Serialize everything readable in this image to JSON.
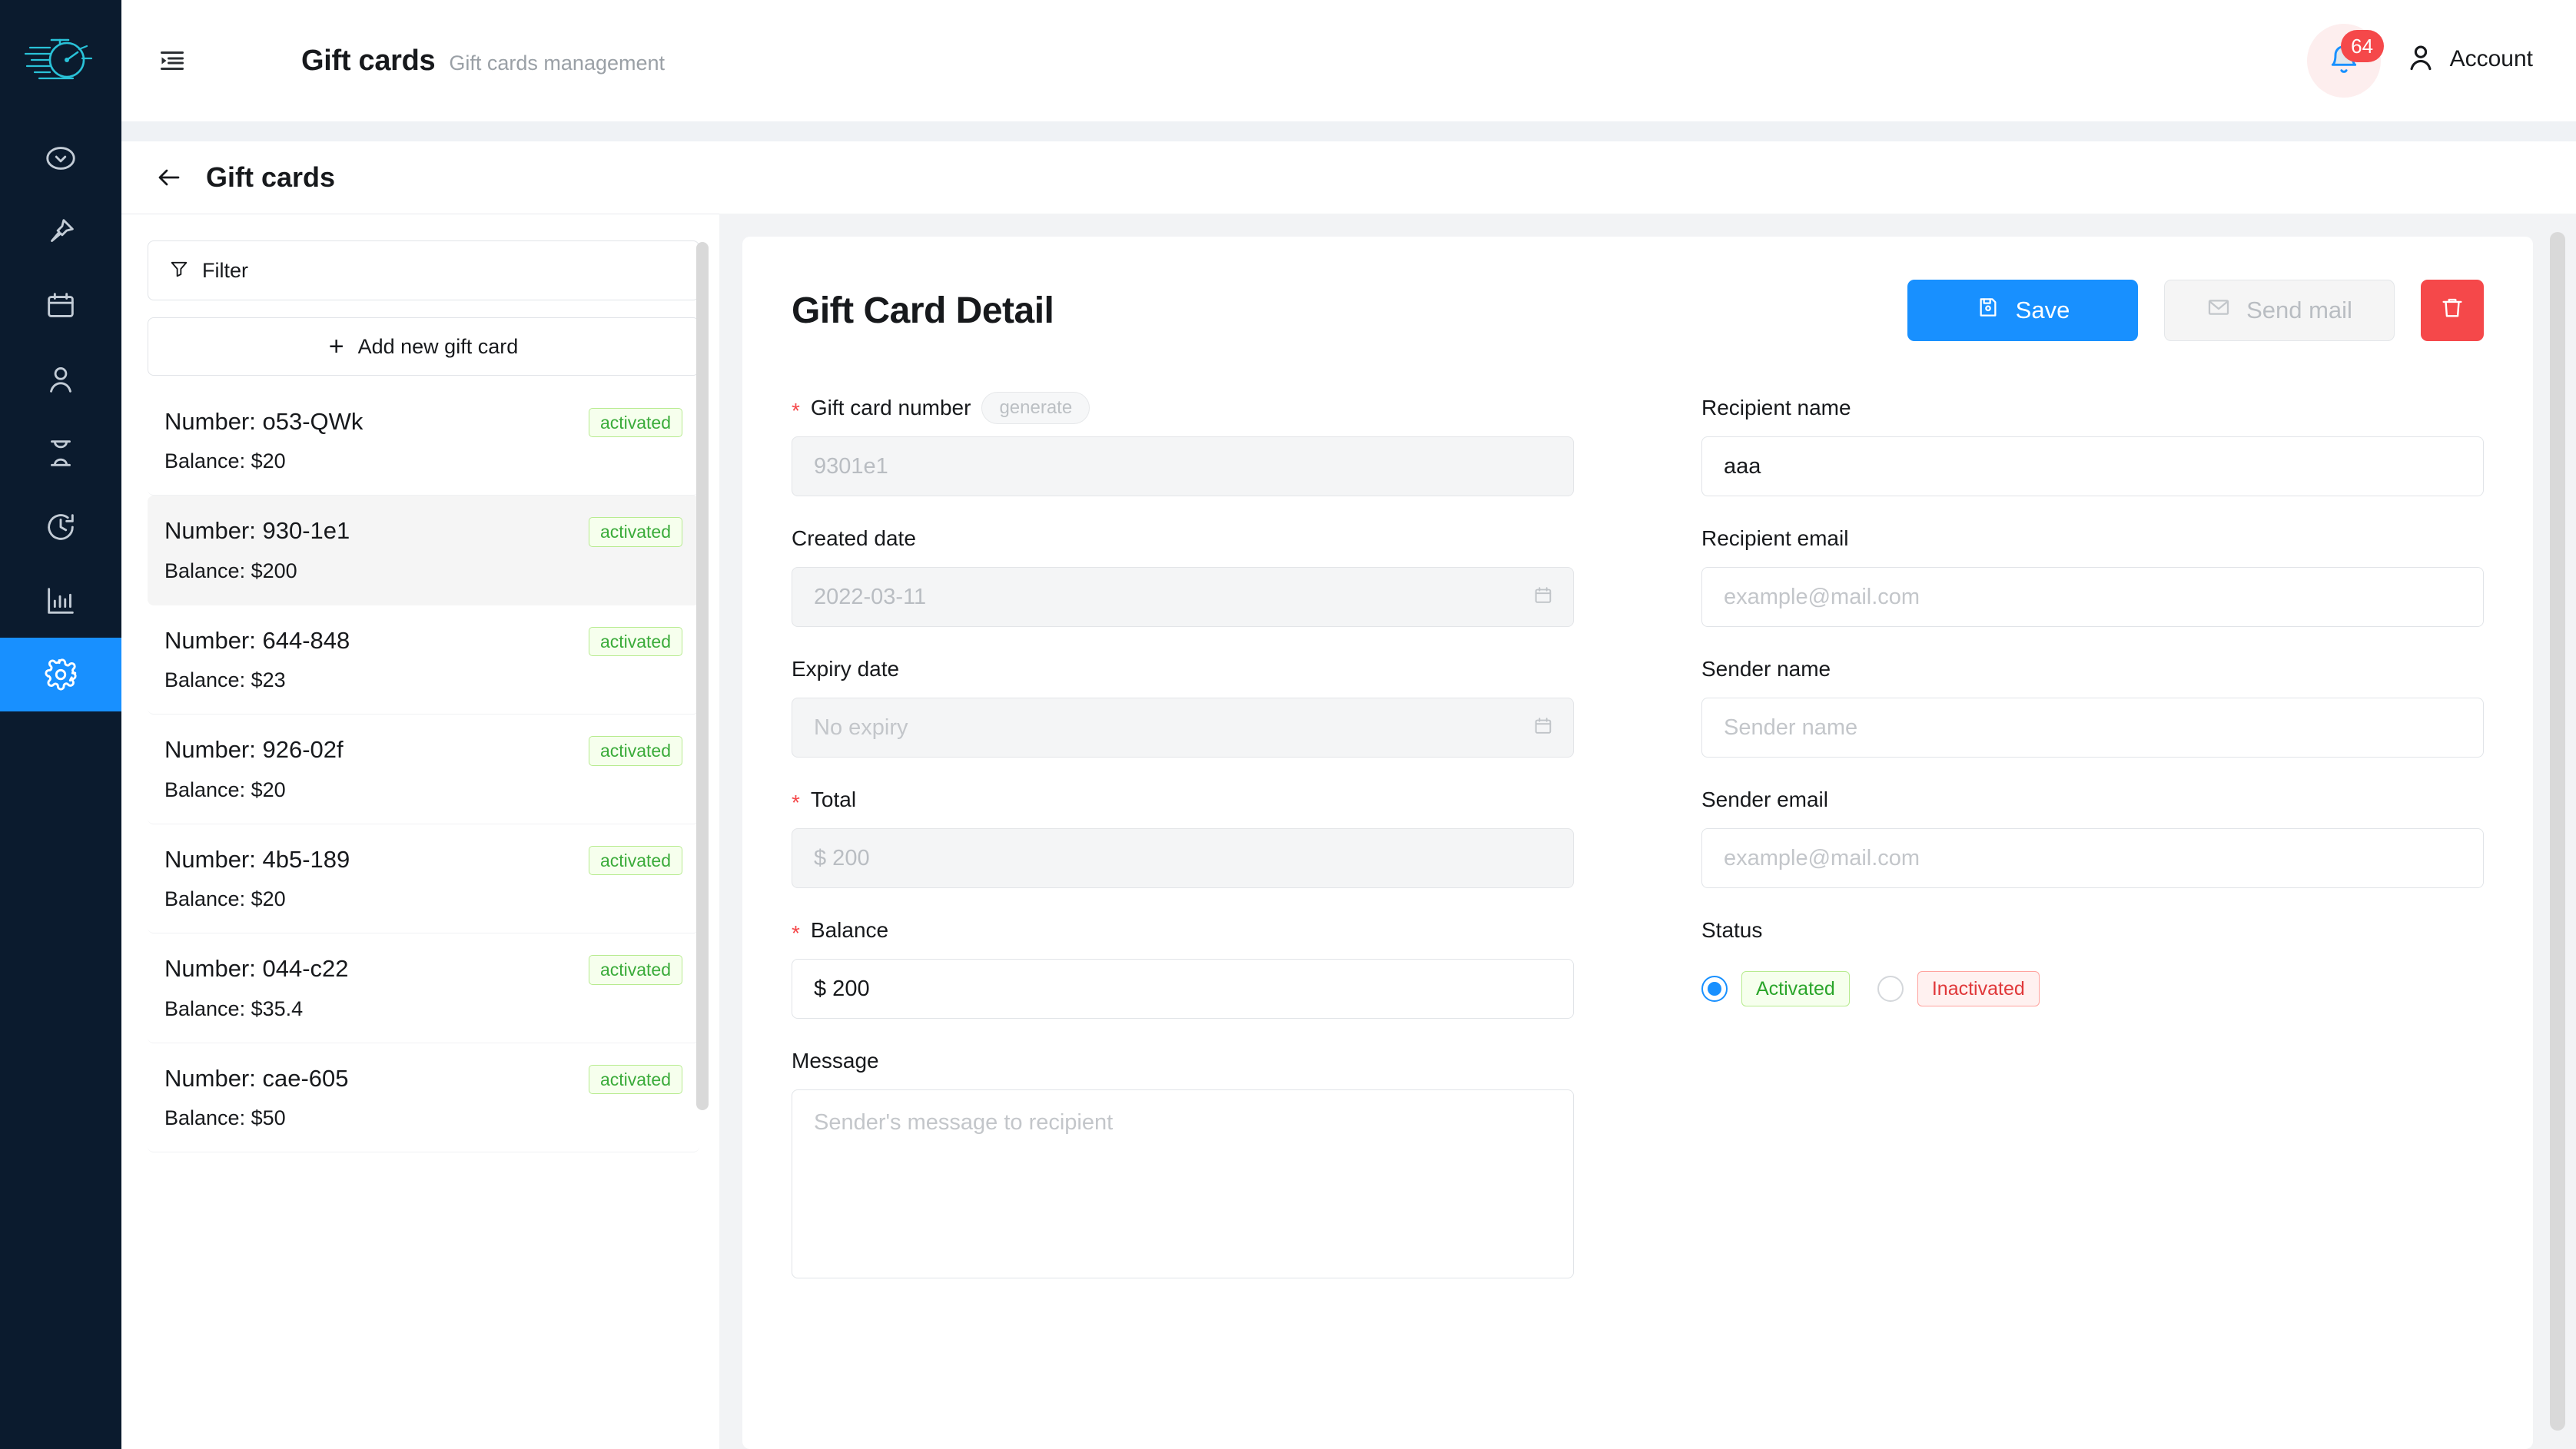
{
  "brand": {
    "accent": "#1890ff",
    "danger": "#f5484a",
    "success": "#3aab3a",
    "rail_bg": "#0b1b2e"
  },
  "rail": {
    "logo_name": "stopwatch-logo",
    "items": [
      {
        "icon": "check-circle-icon",
        "active": false
      },
      {
        "icon": "pin-icon",
        "active": false
      },
      {
        "icon": "calendar-icon",
        "active": false
      },
      {
        "icon": "user-icon",
        "active": false
      },
      {
        "icon": "hourglass-icon",
        "active": false
      },
      {
        "icon": "clock-history-icon",
        "active": false
      },
      {
        "icon": "bar-chart-icon",
        "active": false
      },
      {
        "icon": "gear-icon",
        "active": true
      }
    ]
  },
  "topbar": {
    "collapse_icon": "menu-collapse-icon",
    "title": "Gift cards",
    "subtitle": "Gift cards management",
    "notification_count": "64",
    "account_label": "Account"
  },
  "page": {
    "back_icon": "arrow-left-icon",
    "title": "Gift cards"
  },
  "list_panel": {
    "filter_label": "Filter",
    "filter_icon": "funnel-icon",
    "add_label": "Add new gift card",
    "add_icon": "plus-icon",
    "items": [
      {
        "number": "Number: o53-QWk",
        "balance": "Balance: $20",
        "status": "activated",
        "selected": false
      },
      {
        "number": "Number: 930-1e1",
        "balance": "Balance: $200",
        "status": "activated",
        "selected": true
      },
      {
        "number": "Number: 644-848",
        "balance": "Balance: $23",
        "status": "activated",
        "selected": false
      },
      {
        "number": "Number: 926-02f",
        "balance": "Balance: $20",
        "status": "activated",
        "selected": false
      },
      {
        "number": "Number: 4b5-189",
        "balance": "Balance: $20",
        "status": "activated",
        "selected": false
      },
      {
        "number": "Number: 044-c22",
        "balance": "Balance: $35.4",
        "status": "activated",
        "selected": false
      },
      {
        "number": "Number: cae-605",
        "balance": "Balance: $50",
        "status": "activated",
        "selected": false
      }
    ]
  },
  "detail": {
    "title": "Gift Card Detail",
    "save_label": "Save",
    "save_icon": "save-icon",
    "send_mail_label": "Send mail",
    "send_mail_icon": "mail-icon",
    "delete_icon": "trash-icon",
    "fields": {
      "gift_card_number": {
        "label": "Gift card number",
        "required": "*",
        "generate_label": "generate",
        "value": "9301e1"
      },
      "created_date": {
        "label": "Created date",
        "value": "2022-03-11",
        "icon": "calendar-icon"
      },
      "expiry_date": {
        "label": "Expiry date",
        "placeholder": "No expiry",
        "icon": "calendar-icon"
      },
      "total": {
        "label": "Total",
        "required": "*",
        "value": "$ 200"
      },
      "balance": {
        "label": "Balance",
        "required": "*",
        "value": "$ 200"
      },
      "message": {
        "label": "Message",
        "placeholder": "Sender's message to recipient"
      },
      "recipient_name": {
        "label": "Recipient name",
        "value": "aaa"
      },
      "recipient_email": {
        "label": "Recipient email",
        "placeholder": "example@mail.com"
      },
      "sender_name": {
        "label": "Sender name",
        "placeholder": "Sender name"
      },
      "sender_email": {
        "label": "Sender email",
        "placeholder": "example@mail.com"
      },
      "status": {
        "label": "Status",
        "options": [
          {
            "label": "Activated",
            "selected": true
          },
          {
            "label": "Inactivated",
            "selected": false
          }
        ]
      }
    }
  }
}
